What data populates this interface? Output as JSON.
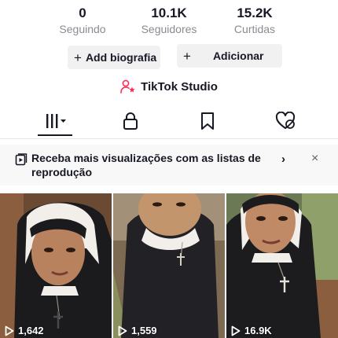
{
  "stats": [
    {
      "value": "0",
      "label": "Seguindo"
    },
    {
      "value": "10.1K",
      "label": "Seguidores"
    },
    {
      "value": "15.2K",
      "label": "Curtidas"
    }
  ],
  "buttons": {
    "bio_label": "Add biografia",
    "add_label": "Adicionar"
  },
  "studio": {
    "label": "TikTok Studio",
    "icon": "user-star-icon"
  },
  "tabs": [
    {
      "icon": "grid-bars-icon",
      "selected": true
    },
    {
      "icon": "lock-icon",
      "selected": false
    },
    {
      "icon": "bookmark-icon",
      "selected": false
    },
    {
      "icon": "heart-hidden-icon",
      "selected": false
    }
  ],
  "banner": {
    "text": "Receba mais visualizações com as listas de reprodução",
    "chevron": "›",
    "close": "×"
  },
  "videos": [
    {
      "views": "1,642"
    },
    {
      "views": "1,559"
    },
    {
      "views": "16.9K"
    }
  ],
  "colors": {
    "text": "#161823",
    "secondary": "#8a8b91",
    "studio_icon": "#fe2c55",
    "button_bg": "#f1f1f2"
  }
}
